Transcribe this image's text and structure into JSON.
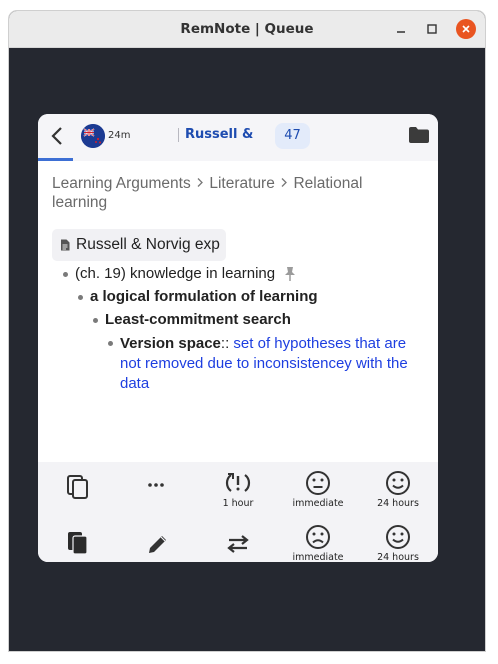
{
  "window": {
    "title": "RemNote | Queue"
  },
  "header": {
    "timer": "24m",
    "queue_name": "Russell &",
    "count": "47"
  },
  "breadcrumb": {
    "parts": [
      "Learning Arguments",
      "Literature",
      "Relational learning"
    ]
  },
  "document": {
    "title": "Russell & Norvig exp"
  },
  "tree": {
    "level1": "(ch. 19) knowledge in learning",
    "level2": "a logical formulation of learning",
    "level3": "Least-commitment search",
    "level4_term": "Version space",
    "level4_sep": "::",
    "level4_answer": "set of hypotheses that are not removed due to inconsistencey with the data"
  },
  "controls": {
    "row1": [
      {
        "icon": "cards-outline-icon",
        "caption": ""
      },
      {
        "icon": "more-dots-icon",
        "caption": ""
      },
      {
        "icon": "skip-retry-icon",
        "caption": "1 hour"
      },
      {
        "icon": "neutral-face-icon",
        "caption": "immediate"
      },
      {
        "icon": "smile-face-icon",
        "caption": "24 hours"
      }
    ],
    "row2": [
      {
        "icon": "cards-filled-icon",
        "caption": ""
      },
      {
        "icon": "pencil-icon",
        "caption": ""
      },
      {
        "icon": "swap-arrows-icon",
        "caption": ""
      },
      {
        "icon": "sad-face-icon",
        "caption": "immediate"
      },
      {
        "icon": "smile-face-icon",
        "caption": "24 hours"
      }
    ]
  },
  "colors": {
    "accent": "#1e4cb0",
    "answer": "#1d3ee0",
    "close_button": "#e95420",
    "background": "#252830"
  }
}
